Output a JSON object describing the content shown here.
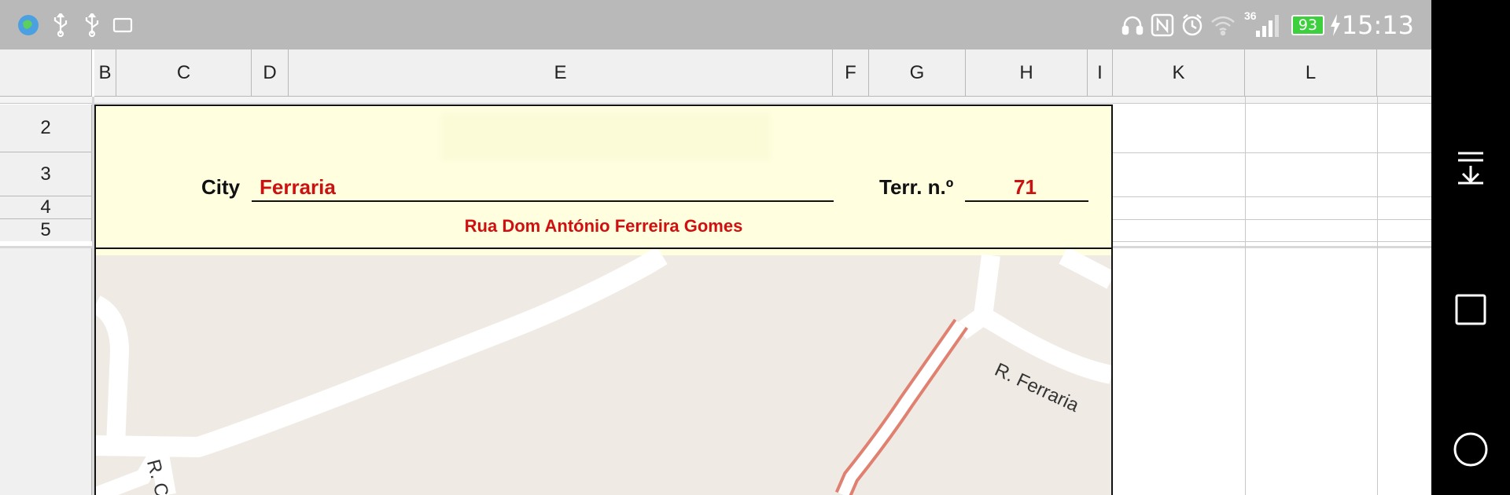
{
  "status_bar": {
    "time": "15:13",
    "battery": "93",
    "signal_label": "36",
    "left_icons": [
      "app-globe-icon",
      "usb-icon",
      "usb-icon",
      "cast-screen-icon"
    ],
    "right_icons": [
      "headphones-icon",
      "nfc-icon",
      "alarm-icon",
      "wifi-icon",
      "signal-icon",
      "battery-icon",
      "charging-icon"
    ]
  },
  "nav_bar": {
    "buttons": [
      "notification-pulldown-icon",
      "recent-apps-icon",
      "home-icon"
    ]
  },
  "sheet": {
    "columns": [
      "B",
      "C",
      "D",
      "E",
      "F",
      "G",
      "H",
      "I",
      "K",
      "L"
    ],
    "rows": [
      "2",
      "3",
      "4",
      "5"
    ]
  },
  "form": {
    "city_label": "City",
    "city_value": "Ferraria",
    "terr_label": "Terr. n.º",
    "terr_value": "71",
    "street": "Rua Dom António Ferreira Gomes"
  },
  "map": {
    "street_labels": [
      "R. Ferraria",
      "R. Ca"
    ],
    "colors": {
      "background": "#efebe4",
      "road": "#ffffff",
      "highlight": "#e08070"
    }
  }
}
